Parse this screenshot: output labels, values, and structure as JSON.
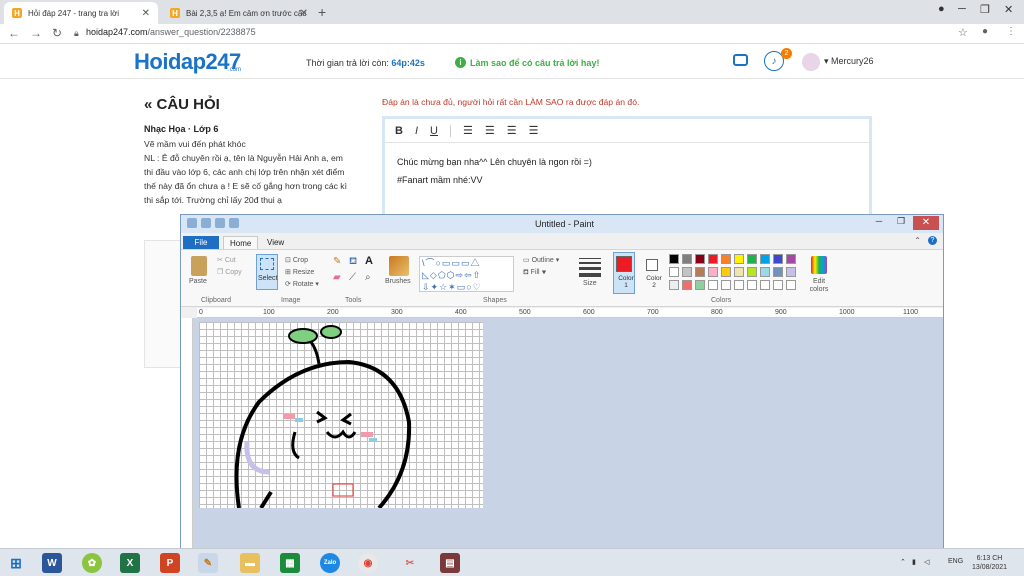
{
  "browser": {
    "tabs": [
      {
        "title": "Hỏi đáp 247 - trang tra lời",
        "favicon": "H"
      },
      {
        "title": "Bài 2,3,5 ạ! Em cảm ơn trước cậu",
        "favicon": "H"
      }
    ],
    "url_domain": "hoidap247.com",
    "url_path": "/answer_question/2238875"
  },
  "site": {
    "logo": "Hoidap247",
    "logo_sub": ".com",
    "timer_label": "Thời gian trả lời còn:",
    "timer_value": "64p:42s",
    "howto": "Làm sao để có câu trả lời hay!",
    "notif_count": "2",
    "username": "Mercury26"
  },
  "question": {
    "title": "« CÂU HỎI",
    "meta": "Nhạc Họa · Lớp 6",
    "body": "Vẽ mầm vui đến phát khóc\nNL : Ê đỗ chuyên rồi ạ, tên là Nguyễn Hải Anh a, em thi đầu vào lớp 6, các anh chị lớp trên nhận xét điểm thế này đã ổn chưa ạ ! E sẽ cố gắng hơn trong các kì thi sắp tới. Trường chỉ lấy 20đ thui ạ"
  },
  "answer": {
    "warning": "Đáp án là chưa đủ, người hỏi rất cần LÀM SAO ra được đáp án đó.",
    "line1": "Chúc mừng bạn nha^^ Lên chuyên là ngon rồi =)",
    "line2": "#Fanart mầm nhé:VV"
  },
  "paint": {
    "title": "Untitled - Paint",
    "tab_file": "File",
    "tab_home": "Home",
    "tab_view": "View",
    "clipboard": {
      "paste": "Paste",
      "cut": "Cut",
      "copy": "Copy",
      "label": "Clipboard"
    },
    "image": {
      "select": "Select",
      "crop": "Crop",
      "resize": "Resize",
      "rotate": "Rotate",
      "label": "Image"
    },
    "tools_label": "Tools",
    "brushes": "Brushes",
    "shapes": {
      "outline": "Outline",
      "fill": "Fill",
      "label": "Shapes"
    },
    "size": "Size",
    "color1": "Color 1",
    "color2": "Color 2",
    "colors_label": "Colors",
    "edit_colors": "Edit colors",
    "ruler_ticks": [
      "0",
      "100",
      "200",
      "300",
      "400",
      "500",
      "600",
      "700",
      "800",
      "900",
      "1000",
      "1100"
    ],
    "palette": [
      "#000000",
      "#7f7f7f",
      "#880015",
      "#ed1c24",
      "#ff7f27",
      "#fff200",
      "#22b14c",
      "#00a2e8",
      "#3f48cc",
      "#a349a4",
      "#ffffff",
      "#c3c3c3",
      "#b97a57",
      "#ffaec9",
      "#ffc90e",
      "#efe4b0",
      "#b5e61d",
      "#99d9ea",
      "#7092be",
      "#c8bfe7",
      "#eeeeee",
      "#f26e6e",
      "#8ed0a0",
      "#ffffff",
      "#ffffff",
      "#ffffff",
      "#ffffff",
      "#ffffff",
      "#ffffff",
      "#ffffff"
    ],
    "color1_value": "#ed1c24",
    "color2_value": "#ffffff"
  },
  "taskbar": {
    "lang": "ENG",
    "time": "6:13 CH",
    "date": "13/08/2021"
  }
}
